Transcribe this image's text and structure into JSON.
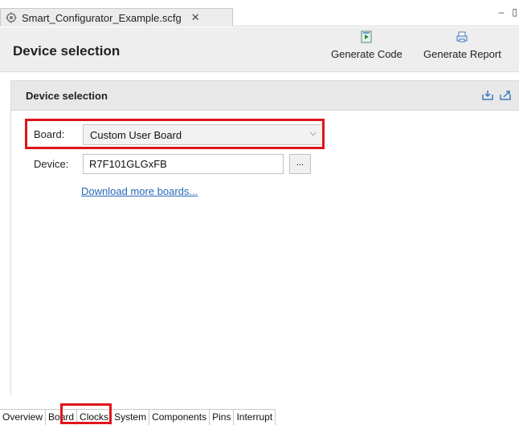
{
  "editor_tab": {
    "title": "Smart_Configurator_Example.scfg",
    "close_glyph": "✕"
  },
  "window_buttons": {
    "minimize": "–",
    "maximize": "▯"
  },
  "header": {
    "title": "Device selection",
    "generate_code": "Generate Code",
    "generate_report": "Generate Report"
  },
  "section": {
    "title": "Device selection",
    "board_label": "Board:",
    "board_value": "Custom User Board",
    "device_label": "Device:",
    "device_value": "R7F101GLGxFB",
    "browse_label": "...",
    "download_link": "Download more boards..."
  },
  "bottom_tabs": [
    "Overview",
    "Board",
    "Clocks",
    "System",
    "Components",
    "Pins",
    "Interrupt"
  ],
  "colors": {
    "highlight": "#e0141b",
    "link": "#2668b5",
    "header_bg": "#eeeeee"
  }
}
